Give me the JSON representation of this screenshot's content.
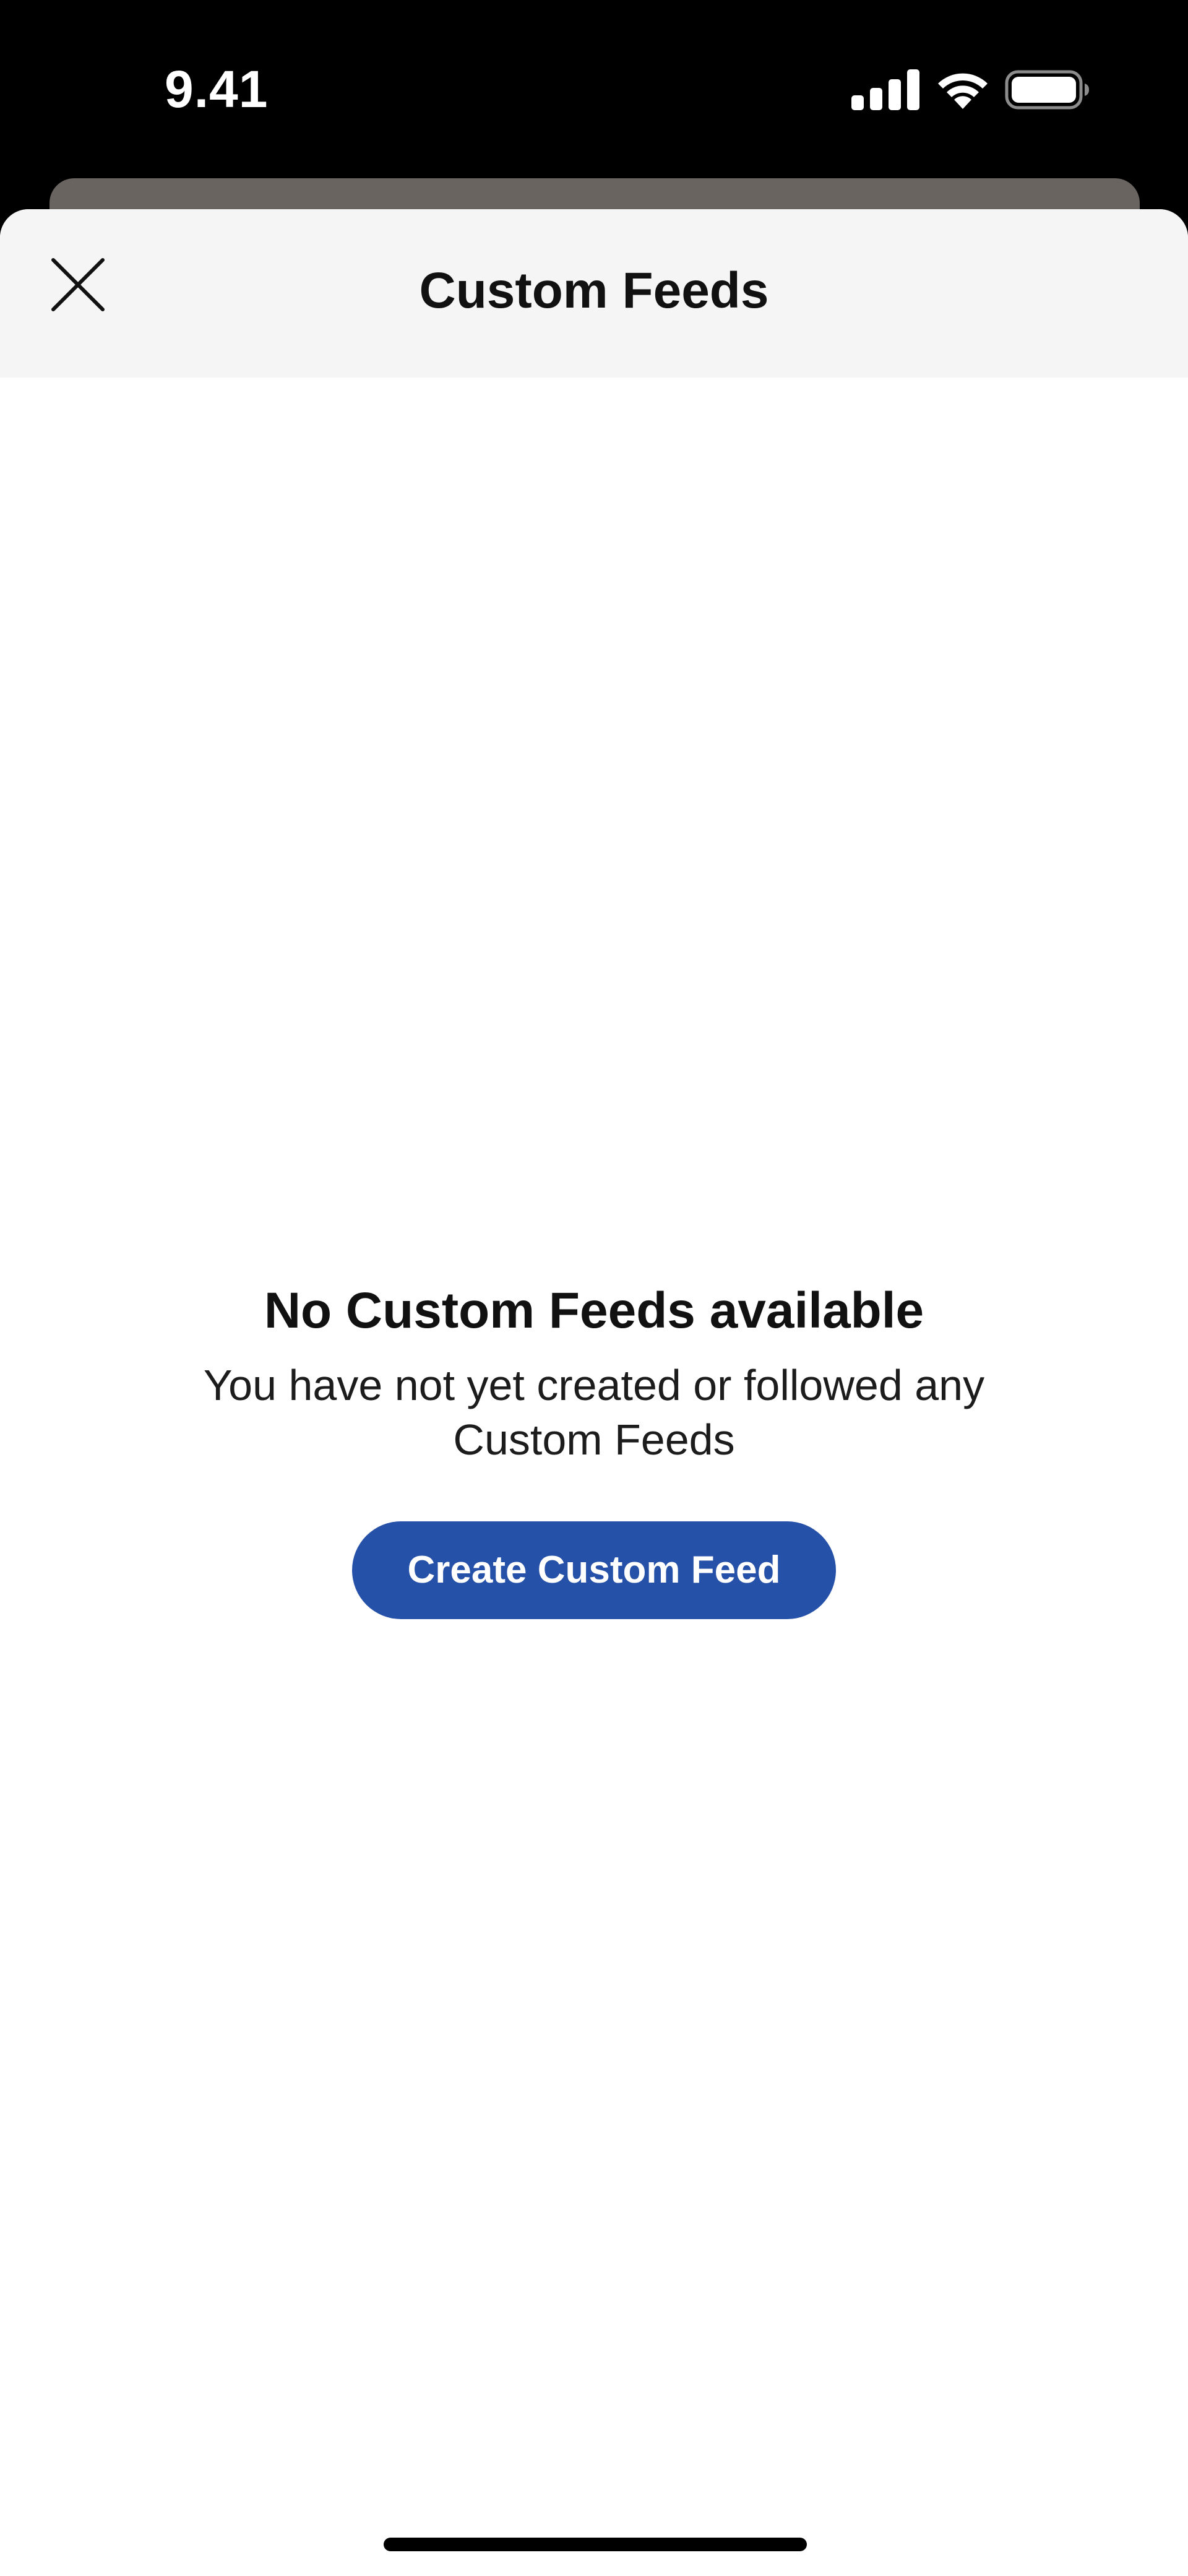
{
  "status_bar": {
    "time": "9.41",
    "icons": [
      "cellular-signal-icon",
      "wifi-icon",
      "battery-icon"
    ]
  },
  "sheet": {
    "title": "Custom Feeds",
    "close_icon": "close-icon"
  },
  "empty_state": {
    "title": "No Custom Feeds available",
    "description": "You have not yet created or followed any Custom Feeds",
    "button_label": "Create Custom Feed"
  },
  "colors": {
    "accent": "#2651a8",
    "header_bg": "#f5f5f5",
    "status_bar_bg": "#000000",
    "back_card": "#6a6460"
  }
}
